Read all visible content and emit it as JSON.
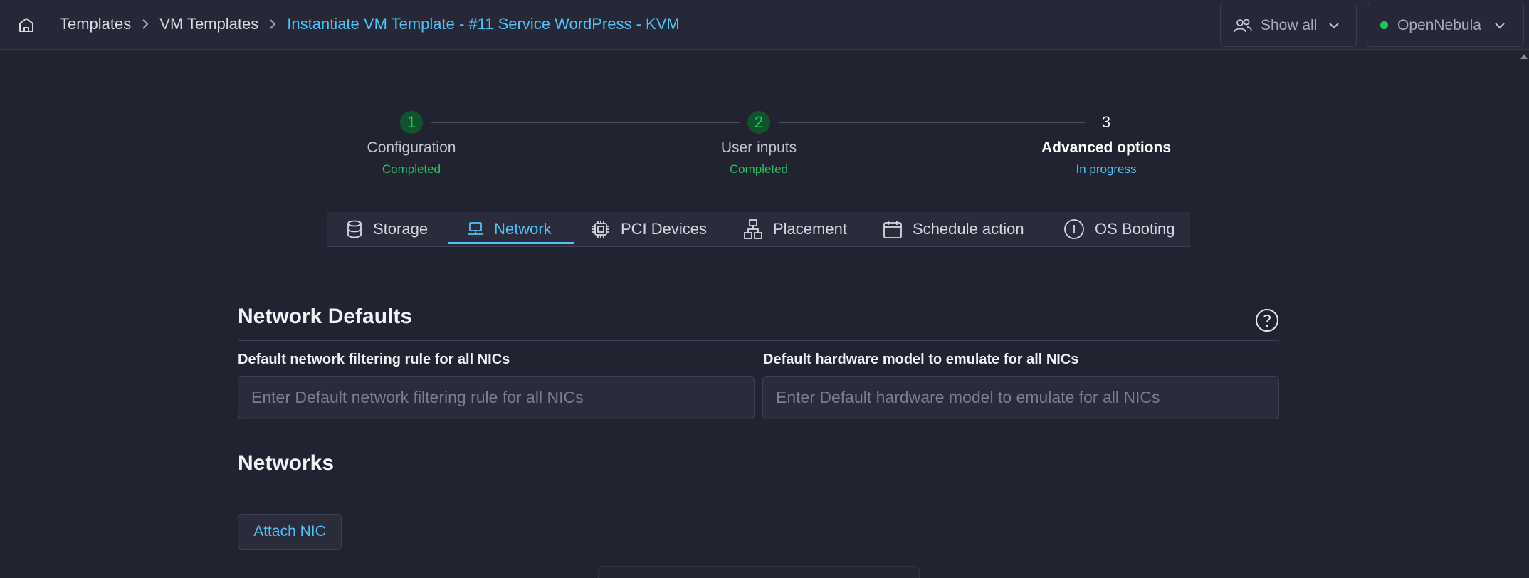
{
  "breadcrumb": {
    "items": [
      "Templates",
      "VM Templates"
    ],
    "current": "Instantiate VM Template - #11 Service WordPress - KVM"
  },
  "header": {
    "show_all_label": "Show all",
    "zone_label": "OpenNebula",
    "zone_status_color": "#22c55e"
  },
  "stepper": {
    "steps": [
      {
        "number": "1",
        "title": "Configuration",
        "status": "Completed"
      },
      {
        "number": "2",
        "title": "User inputs",
        "status": "Completed"
      },
      {
        "number": "3",
        "title": "Advanced options",
        "status": "In progress"
      }
    ]
  },
  "tabs": [
    {
      "label": "Storage",
      "icon": "database-icon"
    },
    {
      "label": "Network",
      "icon": "network-icon",
      "active": true
    },
    {
      "label": "PCI Devices",
      "icon": "chip-icon"
    },
    {
      "label": "Placement",
      "icon": "hierarchy-icon"
    },
    {
      "label": "Schedule action",
      "icon": "calendar-icon"
    },
    {
      "label": "OS Booting",
      "icon": "info-circle-icon"
    }
  ],
  "network_defaults": {
    "title": "Network Defaults",
    "filter_label": "Default network filtering rule for all NICs",
    "filter_placeholder": "Enter Default network filtering rule for all NICs",
    "filter_value": "",
    "model_label": "Default hardware model to emulate for all NICs",
    "model_placeholder": "Enter Default hardware model to emulate for all NICs",
    "model_value": ""
  },
  "networks": {
    "title": "Networks",
    "attach_label": "Attach NIC"
  },
  "colors": {
    "accent": "#4fc3f7",
    "success": "#22c55e",
    "background": "#222330"
  }
}
